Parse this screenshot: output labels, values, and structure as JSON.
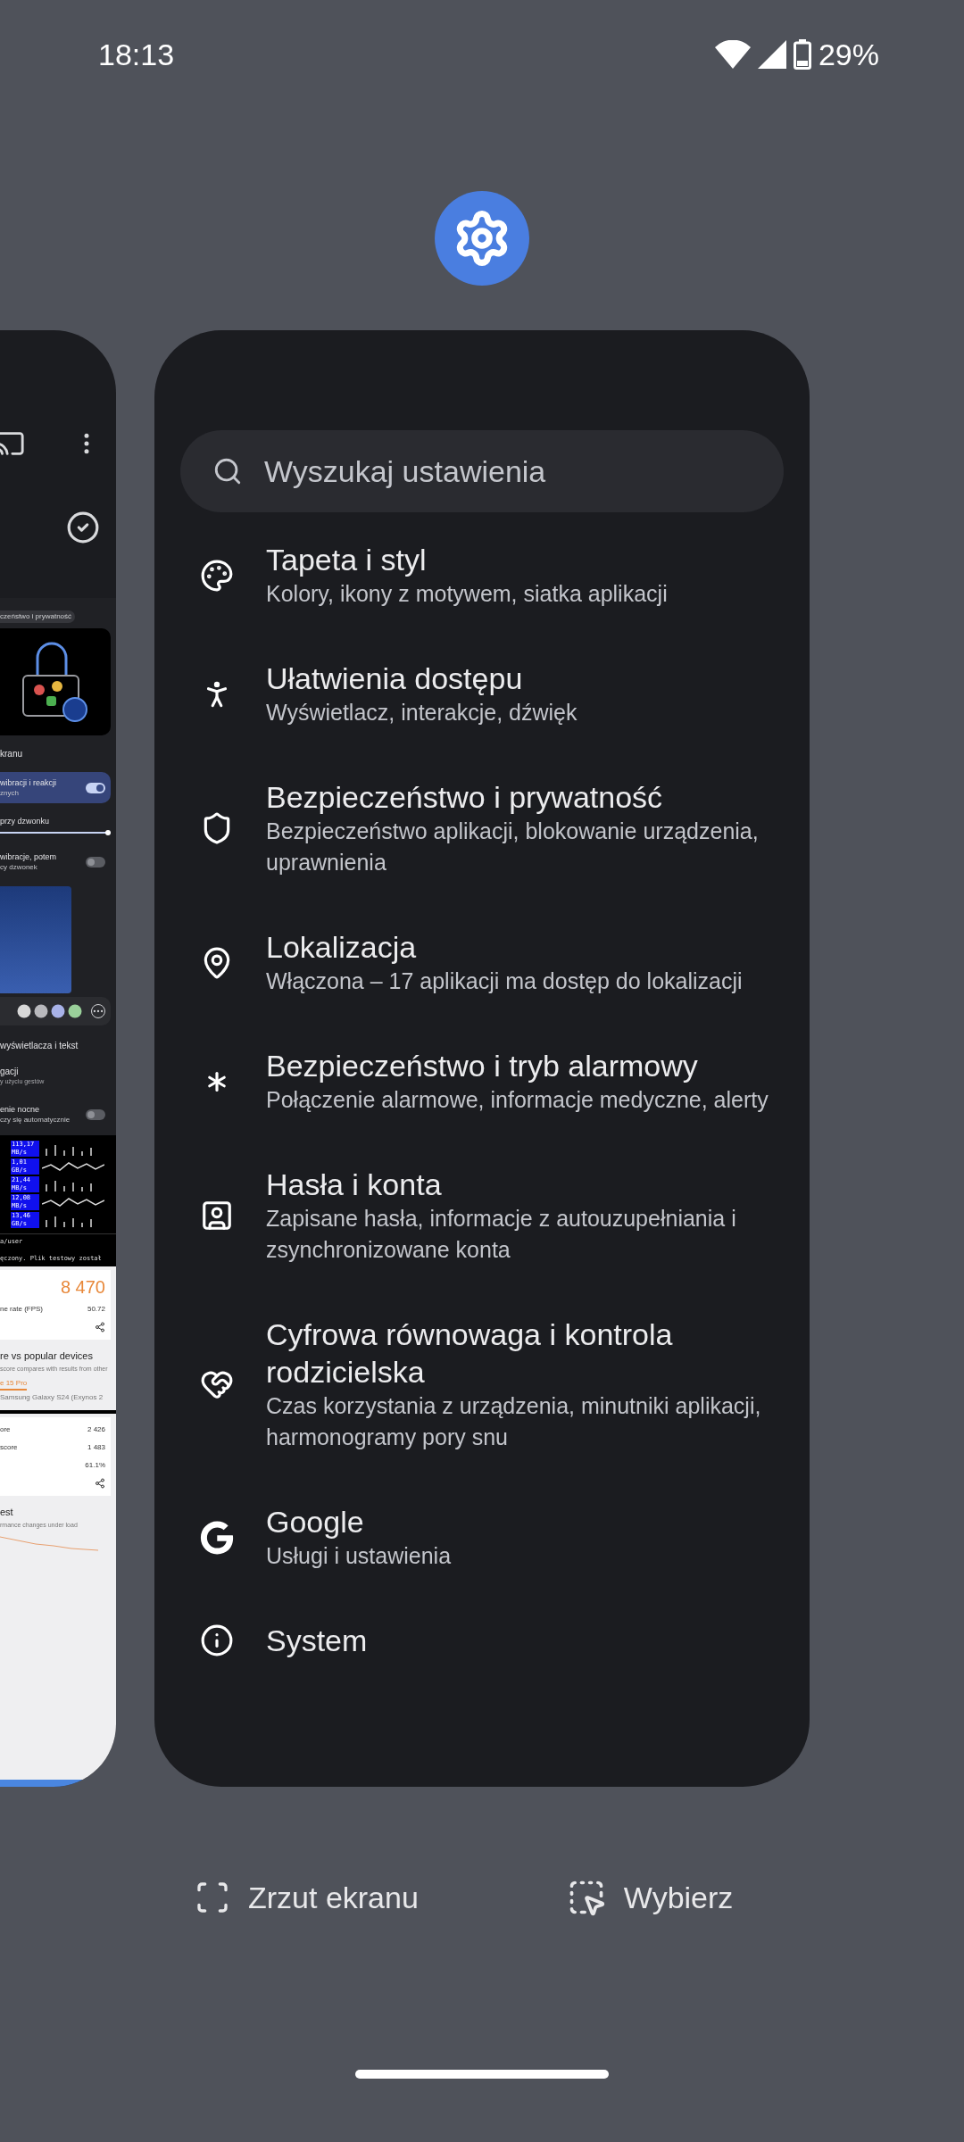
{
  "status_bar": {
    "time": "18:13",
    "battery": "29%"
  },
  "left_task": {
    "blocks": [
      {
        "kind": "toolbar"
      },
      {
        "kind": "chip",
        "text": "czeństwo i prywatność"
      },
      {
        "kind": "illustration"
      },
      {
        "kind": "row",
        "text": "kranu"
      },
      {
        "kind": "toggle",
        "text": "wibracji i reakcji",
        "subtext": "znych",
        "on": true
      },
      {
        "kind": "slider",
        "text": "przy dzwonku",
        "level": 1
      },
      {
        "kind": "toggle",
        "text": "wibracje, potem",
        "subtext": "cy dzwonek",
        "on": false
      },
      {
        "kind": "wallpaper"
      },
      {
        "kind": "swatches"
      },
      {
        "kind": "row",
        "text": "wyświetlacza i tekst"
      },
      {
        "kind": "row",
        "text": "gacji",
        "subtext": "y użyciu gestów"
      },
      {
        "kind": "toggle",
        "text": "enie nocne",
        "subtext": "czy się automatycznie",
        "on": false
      },
      {
        "kind": "speeds",
        "values": [
          "113,17 MB/s",
          "1,01 GB/s",
          "21,44 MB/s",
          "12,08 MB/s",
          "13,46 GB/s"
        ]
      },
      {
        "kind": "terminal",
        "lines": [
          "a/user",
          "ęczony. Plik testowy został"
        ]
      },
      {
        "kind": "score",
        "value": "8 470",
        "label": "ne rate (FPS)",
        "reading": "50.72"
      },
      {
        "kind": "compare",
        "title": "re vs popular devices",
        "text": "score compares with results from other",
        "tabs": [
          {
            "label": "e 15 Pro",
            "selected": true
          },
          {
            "label": "Samsung Galaxy S24 (Exynos 2",
            "selected": false
          }
        ]
      },
      {
        "kind": "stats",
        "rows": [
          {
            "label": "ore",
            "value": "2 426"
          },
          {
            "label": "score",
            "value": "1 483"
          },
          {
            "value": "61.1%"
          }
        ]
      },
      {
        "kind": "test",
        "title": "est",
        "text": "rmance changes under load"
      }
    ]
  },
  "task": {
    "search": {
      "placeholder": "Wyszukaj ustawienia"
    },
    "items": [
      {
        "title": "Tapeta i styl",
        "subtitle": "Kolory, ikony z motywem, siatka aplikacji"
      },
      {
        "title": "Ułatwienia dostępu",
        "subtitle": "Wyświetlacz, interakcje, dźwięk"
      },
      {
        "title": "Bezpieczeństwo i prywatność",
        "subtitle": "Bezpieczeństwo aplikacji, blokowanie urządzenia, uprawnienia"
      },
      {
        "title": "Lokalizacja",
        "subtitle": "Włączona – 17 aplikacji ma dostęp do lokalizacji"
      },
      {
        "title": "Bezpieczeństwo i tryb alarmowy",
        "subtitle": "Połączenie alarmowe, informacje medyczne, alerty"
      },
      {
        "title": "Hasła i konta",
        "subtitle": "Zapisane hasła, informacje z autouzupełniania i zsynchronizowane konta"
      },
      {
        "title": "Cyfrowa równowaga i kontrola rodzicielska",
        "subtitle": "Czas korzystania z urządzenia, minutniki aplikacji, harmonogramy pory snu"
      },
      {
        "title": "Google",
        "subtitle": "Usługi i ustawienia"
      },
      {
        "title": "System"
      }
    ]
  },
  "actions": [
    {
      "label": "Zrzut ekranu"
    },
    {
      "label": "Wybierz"
    }
  ]
}
